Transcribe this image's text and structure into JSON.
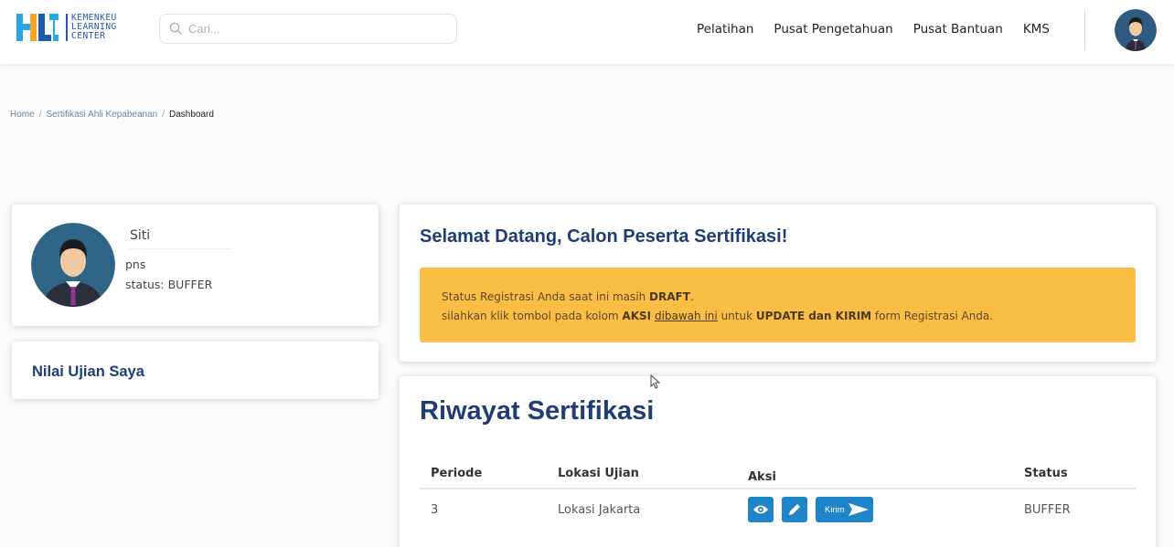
{
  "header": {
    "logo_lines": [
      "KEMENKEU",
      "LEARNING",
      "CENTER"
    ],
    "search_placeholder": "Cari...",
    "nav": [
      "Pelatihan",
      "Pusat Pengetahuan",
      "Pusat Bantuan",
      "KMS"
    ]
  },
  "breadcrumb": {
    "items": [
      "Home",
      "Sertifikasi Ahli Kepabeanan"
    ],
    "current": "Dashboard"
  },
  "profile": {
    "name": "Siti",
    "role": "pns",
    "status": "status: BUFFER"
  },
  "nilai": {
    "title": "Nilai Ujian Saya"
  },
  "welcome": {
    "title": "Selamat Datang, Calon Peserta Sertifikasi!",
    "line1_prefix": "Status Registrasi Anda saat ini masih ",
    "line1_bold": "DRAFT",
    "line1_suffix": ".",
    "line2_prefix": "silahkan klik tombol pada kolom ",
    "line2_bold1": "AKSI",
    "line2_link": "dibawah ini",
    "line2_mid": " untuk ",
    "line2_bold2": "UPDATE dan KIRIM",
    "line2_suffix": " form Registrasi Anda."
  },
  "riwayat": {
    "title": "Riwayat Sertifikasi",
    "columns": [
      "Periode",
      "Lokasi Ujian",
      "Aksi",
      "Status"
    ],
    "rows": [
      {
        "periode": "3",
        "lokasi": "Lokasi Jakarta",
        "kirim_label": "Kirim",
        "status": "BUFFER"
      }
    ]
  },
  "colors": {
    "brand_blue": "#1f3d75",
    "action_blue": "#1f84c8",
    "alert_yellow": "#fbbd44"
  }
}
